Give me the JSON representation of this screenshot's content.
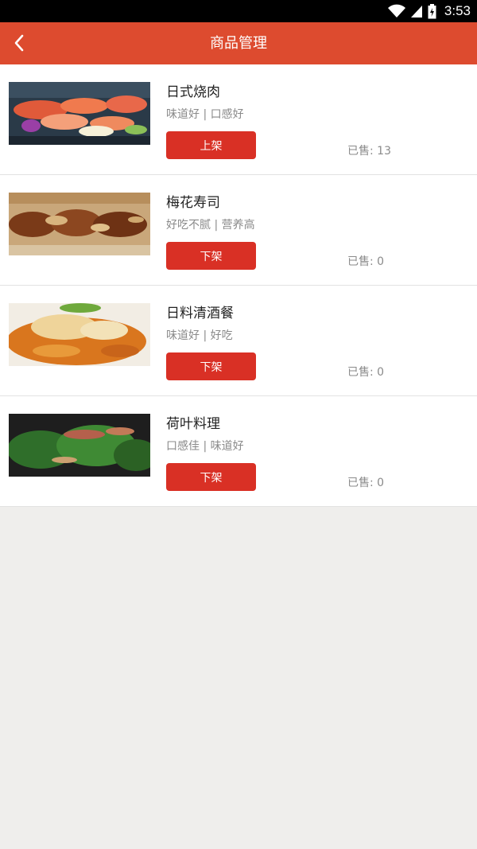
{
  "status_bar": {
    "time": "3:53"
  },
  "header": {
    "title": "商品管理",
    "back_icon": "chevron-left-icon"
  },
  "colors": {
    "header": "#dd4b2f",
    "button": "#d93025",
    "page_bg": "#efeeec"
  },
  "products": [
    {
      "name": "日式烧肉",
      "tags": "味道好 | 口感好",
      "action": "上架",
      "sold": "已售: 13"
    },
    {
      "name": "梅花寿司",
      "tags": "好吃不腻 | 营养高",
      "action": "下架",
      "sold": "已售: 0"
    },
    {
      "name": "日料清酒餐",
      "tags": "味道好 | 好吃",
      "action": "下架",
      "sold": "已售: 0"
    },
    {
      "name": "荷叶料理",
      "tags": "口感佳 | 味道好",
      "action": "下架",
      "sold": "已售: 0"
    }
  ]
}
